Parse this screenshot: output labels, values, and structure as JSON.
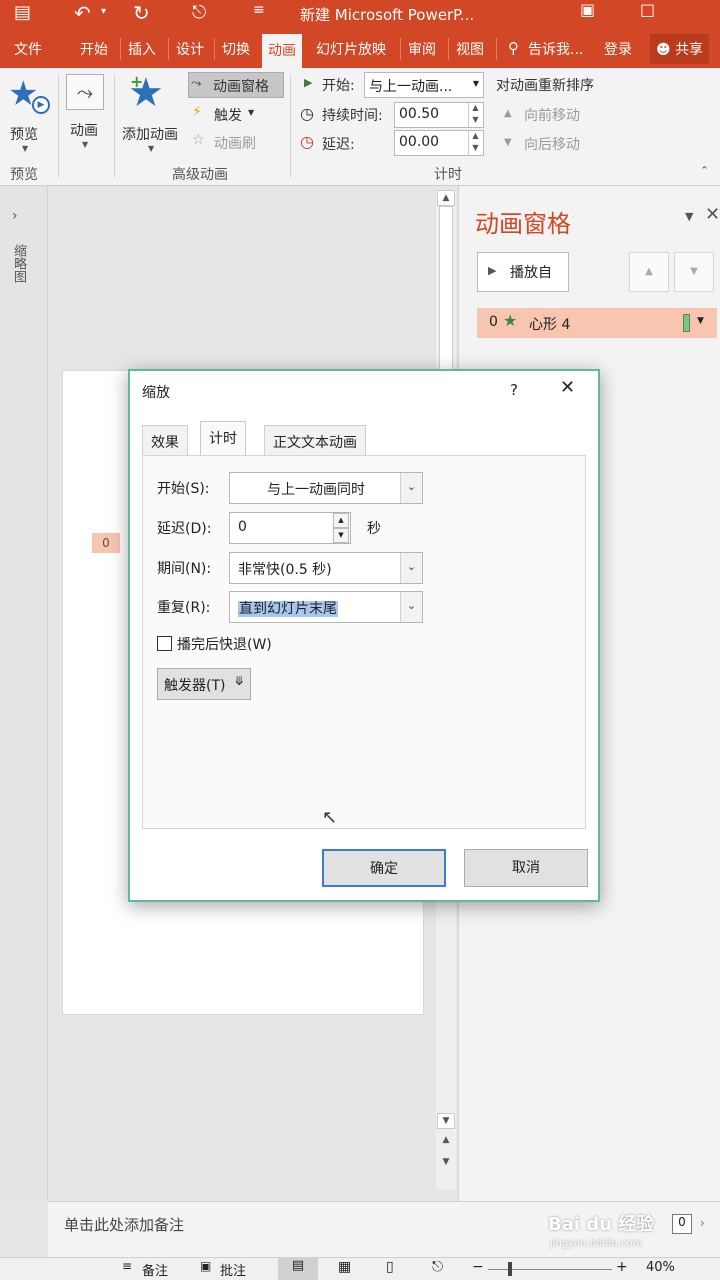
{
  "titlebar": {
    "title": "新建 Microsoft PowerP..."
  },
  "menu": [
    "文件",
    "开始",
    "插入",
    "设计",
    "切换",
    "动画",
    "幻灯片放映",
    "审阅",
    "视图"
  ],
  "menu_active_index": 5,
  "tell_me": "告诉我...",
  "signin": "登录",
  "share": "共享",
  "ribbon": {
    "preview_label": "预览",
    "preview_group": "预览",
    "animation_label": "动画",
    "add_animation": "添加动画",
    "animation_pane": "动画窗格",
    "trigger": "触发",
    "painter": "动画刷",
    "advanced_group": "高级动画",
    "start_label": "开始:",
    "start_value": "与上一动画...",
    "duration_label": "持续时间:",
    "duration_value": "00.50",
    "delay_label": "延迟:",
    "delay_value": "00.00",
    "timing_group": "计时",
    "reorder_title": "对动画重新排序",
    "move_earlier": "向前移动",
    "move_later": "向后移动"
  },
  "left_panel": {
    "label": "缩略图"
  },
  "slide": {
    "anim_tag": "0"
  },
  "anim_pane": {
    "title": "动画窗格",
    "play_from": "播放自",
    "item_index": "0",
    "item_name": "心形 4"
  },
  "dialog": {
    "title": "缩放",
    "help": "?",
    "tabs": [
      "效果",
      "计时",
      "正文文本动画"
    ],
    "selected_tab": 1,
    "start_label": "开始(S):",
    "start_value": "与上一动画同时",
    "delay_label": "延迟(D):",
    "delay_value": "0",
    "delay_unit": "秒",
    "period_label": "期间(N):",
    "period_value": "非常快(0.5 秒)",
    "repeat_label": "重复(R):",
    "repeat_value": "直到幻灯片末尾",
    "rewind_label": "播完后快退(W)",
    "rewind_checked": false,
    "trigger_button": "触发器(T)",
    "ok": "确定",
    "cancel": "取消"
  },
  "notes": {
    "placeholder": "单击此处添加备注"
  },
  "status": {
    "notes": "备注",
    "comments": "批注",
    "zoom": "40%"
  },
  "watermark": {
    "brand": "Bai du 经验",
    "url": "jingyan.baidu.com"
  },
  "colors": {
    "accent": "#d24726",
    "dialog_border": "#5fb8a0",
    "selection": "#a6c8f0",
    "anim_item_bg": "#f8c5b0"
  }
}
